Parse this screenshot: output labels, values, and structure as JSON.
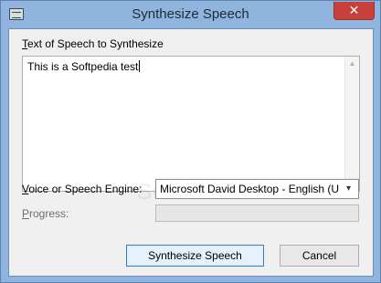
{
  "window": {
    "title": "Synthesize Speech",
    "close_glyph": "✕"
  },
  "text_section": {
    "label_underlined": "T",
    "label_rest": "ext of Speech to Synthesize",
    "value": "This is a Softpedia test"
  },
  "voice": {
    "label_underlined": "V",
    "label_rest": "oice or Speech Engine:",
    "selected": "Microsoft David Desktop - English (United States)",
    "arrow_glyph": "▾"
  },
  "progress": {
    "label_underlined": "P",
    "label_rest": "rogress:",
    "value": 0
  },
  "buttons": {
    "synthesize": "Synthesize Speech",
    "cancel": "Cancel"
  },
  "watermark": "SOFTPEDIA",
  "icons": {
    "app": "app-window-icon",
    "scroll_up": "▲",
    "scroll_down": "▼"
  }
}
